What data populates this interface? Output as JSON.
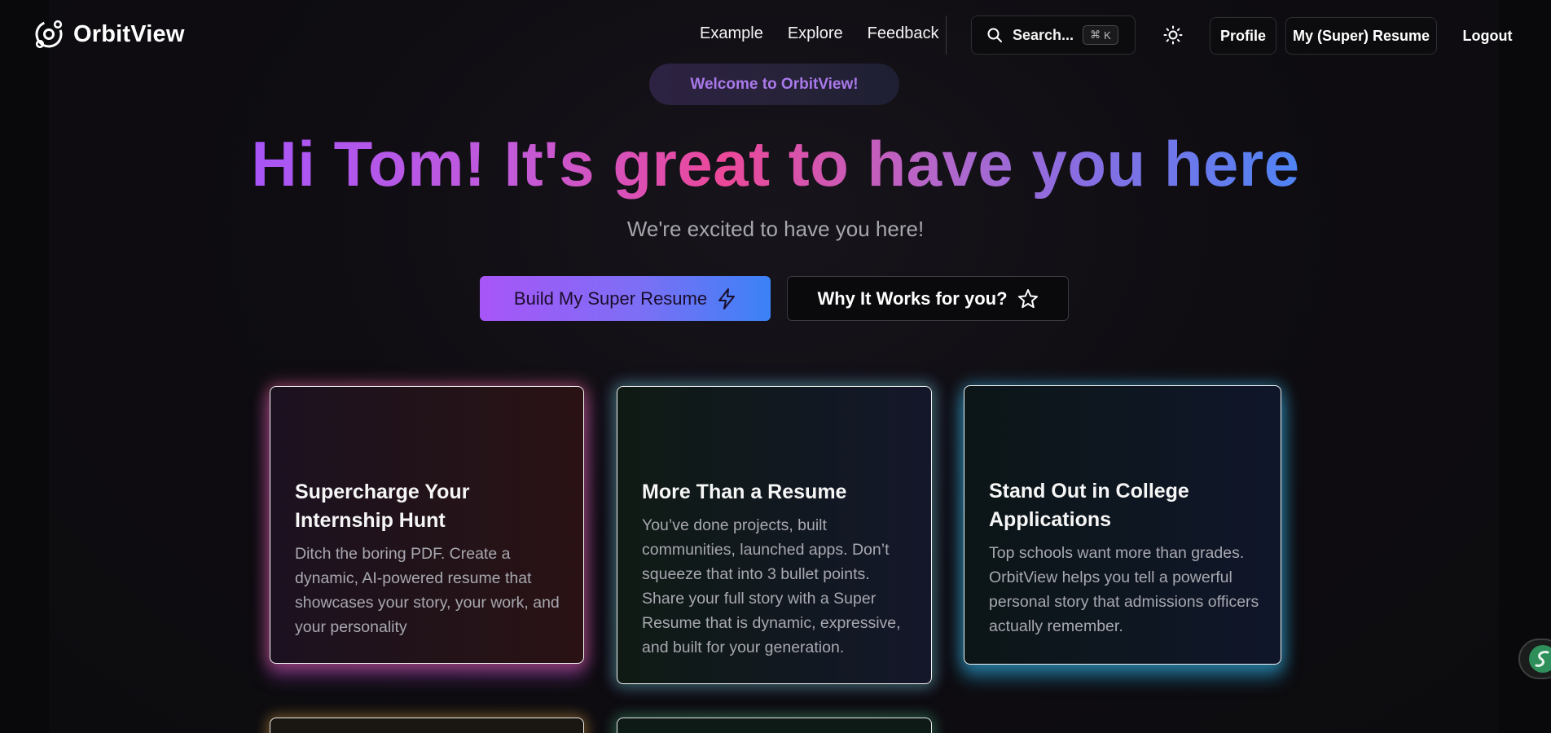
{
  "brand": {
    "name": "OrbitView"
  },
  "nav": {
    "links": [
      "Example",
      "Explore",
      "Feedback"
    ],
    "search": {
      "label": "Search...",
      "shortcut_symbol": "⌘",
      "shortcut_key": "K"
    },
    "buttons": {
      "profile": "Profile",
      "resume": "My (Super) Resume",
      "logout": "Logout"
    }
  },
  "hero": {
    "badge": "Welcome to OrbitView!",
    "title": "Hi Tom! It's great to have you here",
    "subtitle": "We're excited to have you here!",
    "cta_primary": "Build My Super Resume",
    "cta_secondary": "Why It Works for you?"
  },
  "cards": [
    {
      "title": "Supercharge Your Internship Hunt",
      "body": "Ditch the boring PDF. Create a dynamic, AI-powered resume that showcases your story, your work, and your personality"
    },
    {
      "title": "More Than a Resume",
      "body": "You’ve done projects, built communities, launched apps. Don’t squeeze that into 3 bullet points. Share your full story with a Super Resume that is dynamic, expressive, and built for your generation."
    },
    {
      "title": "Stand Out in College Applications",
      "body": "Top schools want more than grades. OrbitView helps you tell a powerful personal story that admissions officers actually remember."
    }
  ],
  "colors": {
    "accent_purple": "#a855f7",
    "accent_pink": "#ec4899",
    "accent_blue": "#3b82f6",
    "background": "#09090b"
  },
  "icons": [
    "orbit-logo-icon",
    "search-icon",
    "sun-icon",
    "lightning-icon",
    "star-icon",
    "chat-widget-icon"
  ]
}
